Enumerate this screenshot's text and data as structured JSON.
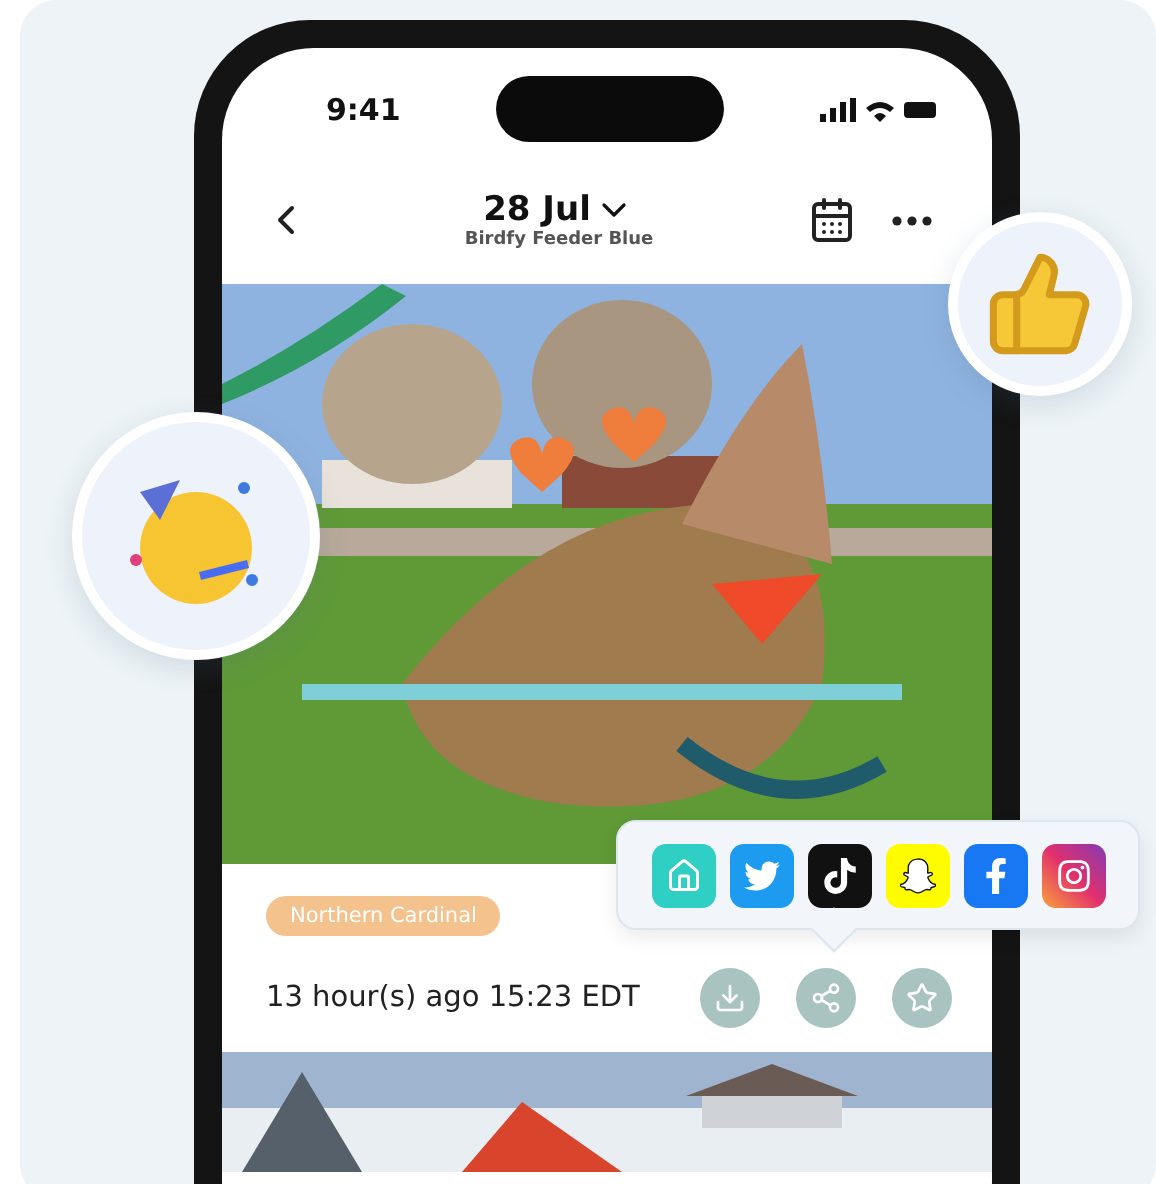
{
  "status_bar": {
    "time": "9:41"
  },
  "header": {
    "date": "28 Jul",
    "device": "Birdfy Feeder Blue"
  },
  "event": {
    "tag": "Northern Cardinal",
    "time": "13 hour(s) ago 15:23 EDT",
    "actions": [
      {
        "kind": "download"
      },
      {
        "kind": "share"
      },
      {
        "kind": "favorite"
      }
    ]
  },
  "share_menu": {
    "targets": [
      {
        "kind": "home"
      },
      {
        "kind": "twitter"
      },
      {
        "kind": "tiktok"
      },
      {
        "kind": "snapchat"
      },
      {
        "kind": "facebook"
      },
      {
        "kind": "instagram"
      }
    ]
  }
}
